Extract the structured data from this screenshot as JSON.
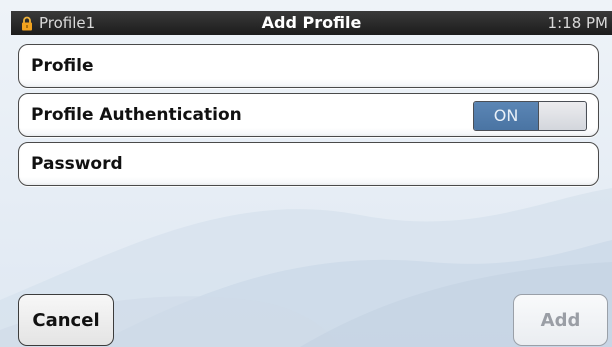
{
  "status_bar": {
    "profile_name": "Profile1",
    "title": "Add Profile",
    "time": "1:18 PM",
    "lock_icon": "lock-icon"
  },
  "form": {
    "profile_label": "Profile",
    "auth_label": "Profile Authentication",
    "auth_toggle_state": "ON",
    "password_label": "Password"
  },
  "buttons": {
    "cancel_label": "Cancel",
    "add_label": "Add",
    "add_enabled": false
  },
  "colors": {
    "status_bar_bg": "#1c1c1c",
    "toggle_on": "#4a74a3",
    "background": "#e6edf5"
  }
}
